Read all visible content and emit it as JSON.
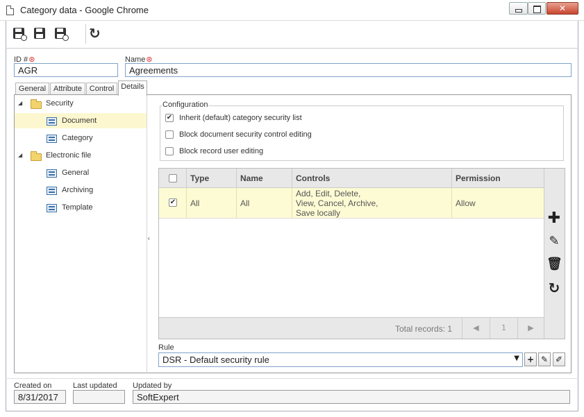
{
  "window": {
    "title": "Category data - Google Chrome"
  },
  "toolbar": {
    "buttons": [
      {
        "name": "save-new",
        "icon": "floppy-plus-icon"
      },
      {
        "name": "save",
        "icon": "floppy-icon"
      },
      {
        "name": "save-close",
        "icon": "floppy-close-icon"
      },
      {
        "name": "refresh",
        "icon": "refresh-icon"
      }
    ]
  },
  "form": {
    "id_label": "ID #",
    "id_value": "AGR",
    "name_label": "Name",
    "name_value": "Agreements"
  },
  "tabs": [
    {
      "label": "General",
      "active": false
    },
    {
      "label": "Attribute",
      "active": false
    },
    {
      "label": "Control",
      "active": false
    },
    {
      "label": "Details",
      "active": true
    }
  ],
  "tree": {
    "nodes": [
      {
        "label": "Security",
        "type": "folder",
        "expanded": true,
        "level": 0
      },
      {
        "label": "Document",
        "type": "item",
        "level": 1,
        "selected": true
      },
      {
        "label": "Category",
        "type": "item",
        "level": 1
      },
      {
        "label": "Electronic file",
        "type": "folder",
        "expanded": true,
        "level": 0
      },
      {
        "label": "General",
        "type": "item",
        "level": 1
      },
      {
        "label": "Archiving",
        "type": "item",
        "level": 1
      },
      {
        "label": "Template",
        "type": "item",
        "level": 1
      }
    ]
  },
  "configuration": {
    "legend": "Configuration",
    "options": [
      {
        "label": "Inherit (default) category security list",
        "checked": true
      },
      {
        "label": "Block document security control editing",
        "checked": false
      },
      {
        "label": "Block record user editing",
        "checked": false
      }
    ]
  },
  "grid": {
    "columns": [
      "Type",
      "Name",
      "Controls",
      "Permission"
    ],
    "rows": [
      {
        "checked": true,
        "type": "All",
        "name": "All",
        "controls": [
          "Add, Edit, Delete,",
          "View, Cancel, Archive,",
          "Save locally"
        ],
        "permission": "Allow"
      }
    ],
    "footer": {
      "total": "Total records: 1",
      "page": "1"
    },
    "side_tools": [
      "add-icon",
      "edit-icon",
      "delete-icon",
      "refresh-icon"
    ]
  },
  "rule": {
    "label": "Rule",
    "value": "DSR - Default security rule"
  },
  "footer": {
    "created_label": "Created on",
    "created_value": "8/31/2017",
    "updated_label": "Last updated",
    "updated_value": "",
    "updated_by_label": "Updated by",
    "updated_by_value": "SoftExpert"
  }
}
